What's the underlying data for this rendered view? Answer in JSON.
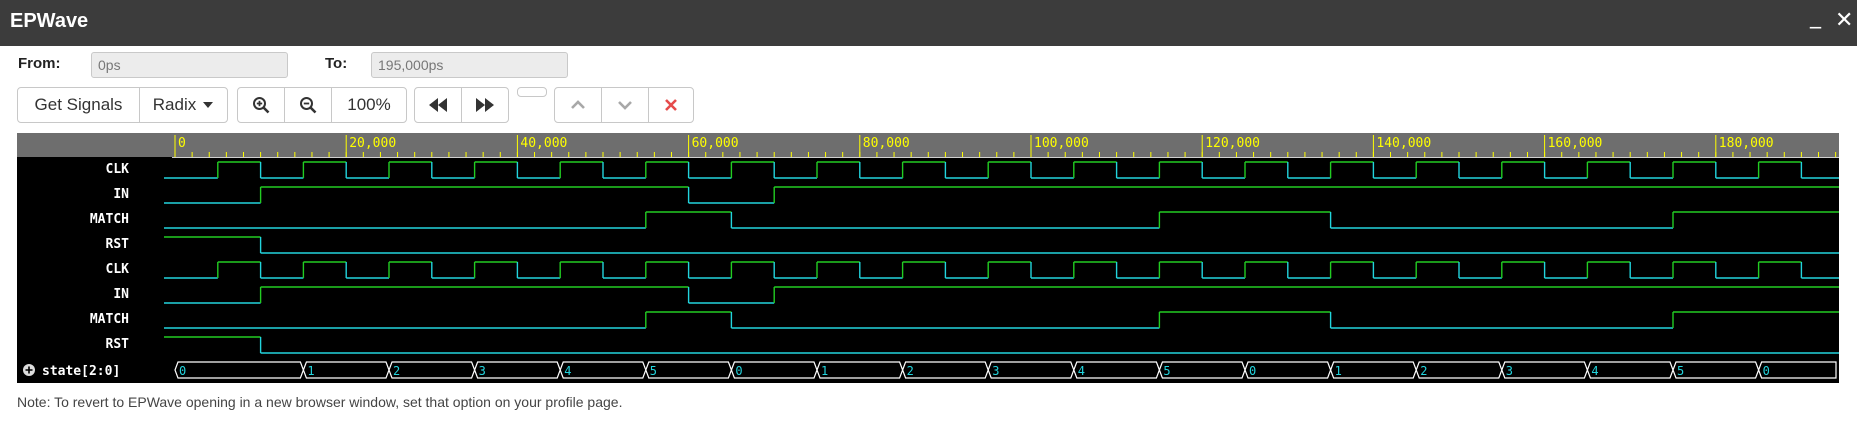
{
  "window": {
    "title": "EPWave",
    "minimize_glyph": "_",
    "close_glyph": "✕"
  },
  "range": {
    "from_label": "From:",
    "from_value": "0ps",
    "to_label": "To:",
    "to_value": "195,000ps"
  },
  "toolbar": {
    "get_signals_label": "Get Signals",
    "radix_label": "Radix",
    "radix_icon": "caret-down-icon",
    "zoom_in_icon": "zoom-in-icon",
    "zoom_out_icon": "zoom-out-icon",
    "zoom_level": "100%",
    "prev_icon": "rewind-icon",
    "next_icon": "fast-forward-icon",
    "up_icon": "chevron-up-icon",
    "down_icon": "chevron-down-icon",
    "remove_icon": "close-icon"
  },
  "timeline": {
    "ticks": [
      "0",
      "20,000",
      "40,000",
      "60,000",
      "80,000",
      "100,000",
      "120,000",
      "140,000",
      "160,000",
      "180,000"
    ],
    "tick_values": [
      0,
      20000,
      40000,
      60000,
      80000,
      100000,
      120000,
      140000,
      160000,
      180000
    ],
    "range_max": 195000
  },
  "signals": [
    {
      "name": "CLK"
    },
    {
      "name": "IN"
    },
    {
      "name": "MATCH"
    },
    {
      "name": "RST"
    },
    {
      "name": "CLK"
    },
    {
      "name": "IN"
    },
    {
      "name": "MATCH"
    },
    {
      "name": "RST"
    }
  ],
  "clock": {
    "first_edge": 5000,
    "half_period": 5000
  },
  "waves": {
    "IN": {
      "initial": 0,
      "transitions": [
        [
          10000,
          1
        ],
        [
          60000,
          0
        ],
        [
          70000,
          1
        ]
      ]
    },
    "MATCH": {
      "initial": 0,
      "transitions": [
        [
          55000,
          1
        ],
        [
          65000,
          0
        ],
        [
          115000,
          1
        ],
        [
          135000,
          0
        ],
        [
          175000,
          1
        ]
      ]
    },
    "RST": {
      "initial": 1,
      "transitions": [
        [
          10000,
          0
        ]
      ]
    }
  },
  "bus": {
    "name": "state[2:0]",
    "expand_icon": "plus-circle-icon",
    "segments": [
      {
        "t": 0,
        "v": "0"
      },
      {
        "t": 15000,
        "v": "1"
      },
      {
        "t": 25000,
        "v": "2"
      },
      {
        "t": 35000,
        "v": "3"
      },
      {
        "t": 45000,
        "v": "4"
      },
      {
        "t": 55000,
        "v": "5"
      },
      {
        "t": 65000,
        "v": "0"
      },
      {
        "t": 75000,
        "v": "1"
      },
      {
        "t": 85000,
        "v": "2"
      },
      {
        "t": 95000,
        "v": "3"
      },
      {
        "t": 105000,
        "v": "4"
      },
      {
        "t": 115000,
        "v": "5"
      },
      {
        "t": 125000,
        "v": "0"
      },
      {
        "t": 135000,
        "v": "1"
      },
      {
        "t": 145000,
        "v": "2"
      },
      {
        "t": 155000,
        "v": "3"
      },
      {
        "t": 165000,
        "v": "4"
      },
      {
        "t": 175000,
        "v": "5"
      },
      {
        "t": 185000,
        "v": "0"
      }
    ]
  },
  "colors": {
    "timeline_bg": "#6e6e6e",
    "timeline_text": "#ffff00",
    "wave_bg": "#000000",
    "wave_high": "#22cc22",
    "wave_low": "#22d4dd",
    "signal_label": "#ffffff",
    "remove_red": "#e64b4b"
  },
  "note": "Note: To revert to EPWave opening in a new browser window, set that option on your profile page."
}
